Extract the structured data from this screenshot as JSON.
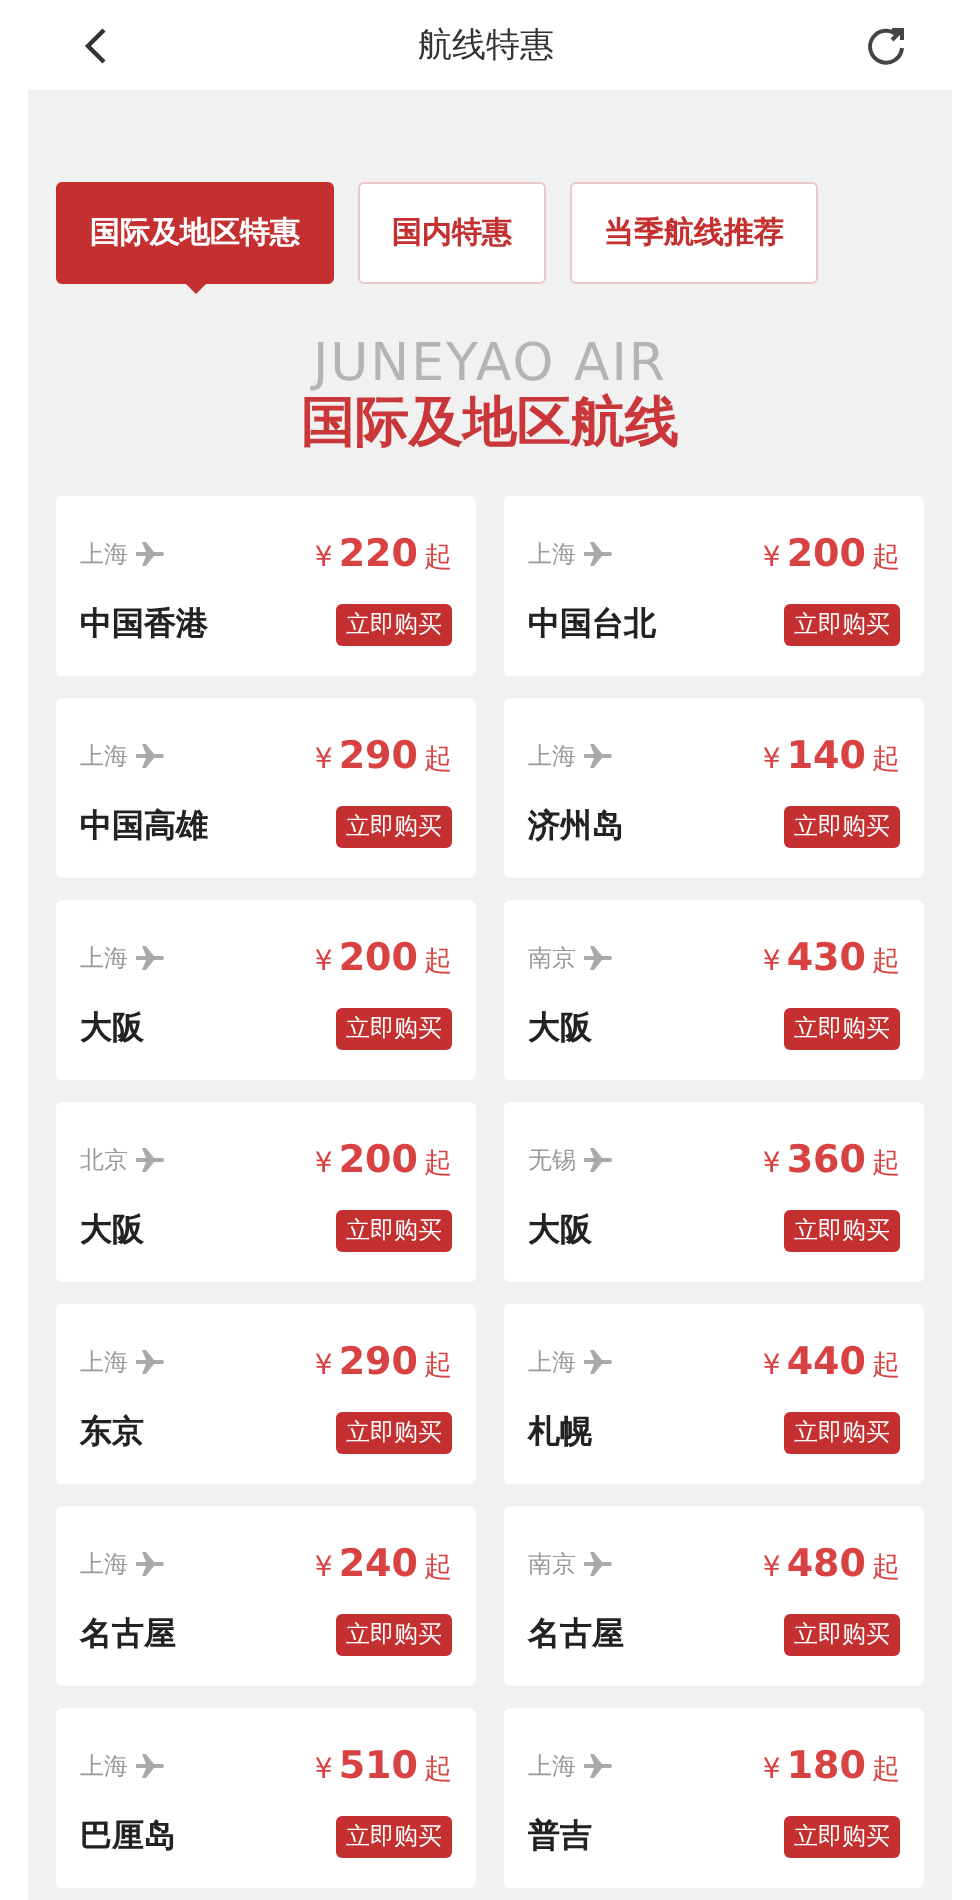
{
  "header": {
    "title": "航线特惠"
  },
  "tabs": [
    {
      "label": "国际及地区特惠",
      "selected": true
    },
    {
      "label": "国内特惠",
      "selected": false
    },
    {
      "label": "当季航线推荐",
      "selected": false
    }
  ],
  "section": {
    "backdrop": "JUNEYAO AIR",
    "title": "国际及地区航线"
  },
  "routes": [
    {
      "from": "上海",
      "to": "中国香港",
      "currency": "¥",
      "price": "220",
      "suffix": "起",
      "action": "立即购买"
    },
    {
      "from": "上海",
      "to": "中国台北",
      "currency": "¥",
      "price": "200",
      "suffix": "起",
      "action": "立即购买"
    },
    {
      "from": "上海",
      "to": "中国高雄",
      "currency": "¥",
      "price": "290",
      "suffix": "起",
      "action": "立即购买"
    },
    {
      "from": "上海",
      "to": "济州岛",
      "currency": "¥",
      "price": "140",
      "suffix": "起",
      "action": "立即购买"
    },
    {
      "from": "上海",
      "to": "大阪",
      "currency": "¥",
      "price": "200",
      "suffix": "起",
      "action": "立即购买"
    },
    {
      "from": "南京",
      "to": "大阪",
      "currency": "¥",
      "price": "430",
      "suffix": "起",
      "action": "立即购买"
    },
    {
      "from": "北京",
      "to": "大阪",
      "currency": "¥",
      "price": "200",
      "suffix": "起",
      "action": "立即购买"
    },
    {
      "from": "无锡",
      "to": "大阪",
      "currency": "¥",
      "price": "360",
      "suffix": "起",
      "action": "立即购买"
    },
    {
      "from": "上海",
      "to": "东京",
      "currency": "¥",
      "price": "290",
      "suffix": "起",
      "action": "立即购买"
    },
    {
      "from": "上海",
      "to": "札幌",
      "currency": "¥",
      "price": "440",
      "suffix": "起",
      "action": "立即购买"
    },
    {
      "from": "上海",
      "to": "名古屋",
      "currency": "¥",
      "price": "240",
      "suffix": "起",
      "action": "立即购买"
    },
    {
      "from": "南京",
      "to": "名古屋",
      "currency": "¥",
      "price": "480",
      "suffix": "起",
      "action": "立即购买"
    },
    {
      "from": "上海",
      "to": "巴厘岛",
      "currency": "¥",
      "price": "510",
      "suffix": "起",
      "action": "立即购买"
    },
    {
      "from": "上海",
      "to": "普吉",
      "currency": "¥",
      "price": "180",
      "suffix": "起",
      "action": "立即购买"
    }
  ]
}
